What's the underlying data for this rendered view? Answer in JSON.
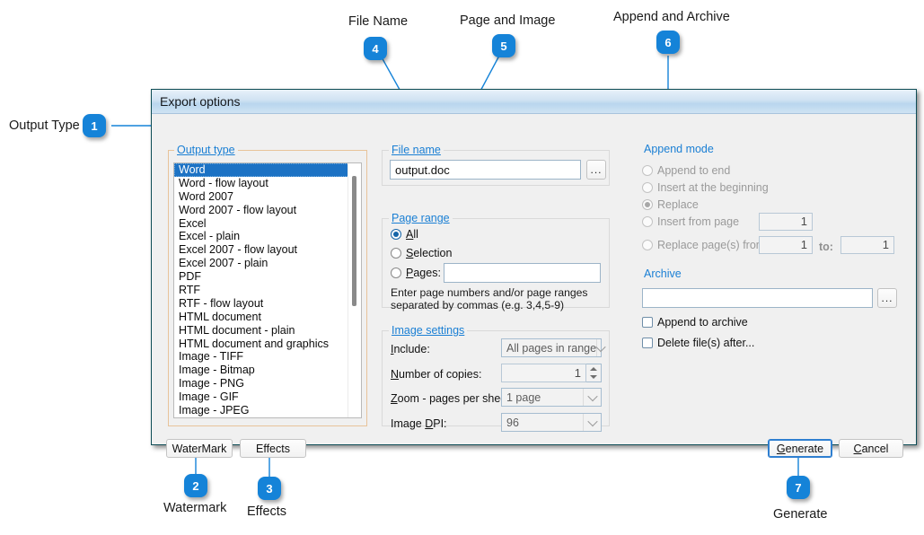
{
  "dialog": {
    "title": "Export options",
    "output_type": {
      "group_label": "Output type",
      "items": [
        "Word",
        "Word - flow layout",
        "Word 2007",
        "Word 2007 - flow layout",
        "Excel",
        "Excel - plain",
        "Excel 2007 - flow layout",
        "Excel 2007 - plain",
        "PDF",
        "RTF",
        "RTF - flow layout",
        "HTML document",
        "HTML document - plain",
        "HTML document and graphics",
        "Image - TIFF",
        "Image - Bitmap",
        "Image - PNG",
        "Image - GIF",
        "Image - JPEG"
      ],
      "selected_index": 0
    },
    "file_name": {
      "group_label": "File name",
      "value": "output.doc",
      "browse_label": "..."
    },
    "page_range": {
      "group_label": "Page range",
      "options": [
        {
          "label": "All",
          "accel": "A",
          "selected": true
        },
        {
          "label": "Selection",
          "accel": "S",
          "selected": false
        },
        {
          "label": "Pages:",
          "accel": "P",
          "selected": false
        }
      ],
      "pages_value": "",
      "hint_line1": "Enter page numbers and/or page ranges",
      "hint_line2": "separated by commas (e.g. 3,4,5-9)"
    },
    "image_settings": {
      "group_label": "Image settings",
      "rows": [
        {
          "label": "Include:",
          "accel": "I",
          "value": "All pages in range",
          "control": "combo"
        },
        {
          "label": "Number of copies:",
          "accel": "N",
          "value": "1",
          "control": "spinner"
        },
        {
          "label": "Zoom - pages per sheet:",
          "accel": "Z",
          "value": "1 page",
          "control": "combo"
        },
        {
          "label": "Image DPI:",
          "accel": "D",
          "value": "96",
          "control": "combo"
        }
      ]
    },
    "append_mode": {
      "group_label": "Append mode",
      "options": [
        {
          "label": "Append to end",
          "selected": false
        },
        {
          "label": "Insert at the beginning",
          "selected": false
        },
        {
          "label": "Replace",
          "selected": true
        },
        {
          "label": "Insert from page",
          "selected": false,
          "value": "1"
        },
        {
          "label": "Replace page(s) from:",
          "selected": false,
          "value": "1",
          "to_label": "to:",
          "to_value": "1"
        }
      ]
    },
    "archive": {
      "group_label": "Archive",
      "path_value": "",
      "browse_label": "...",
      "checkboxes": [
        {
          "label": "Append to archive",
          "checked": false
        },
        {
          "label": "Delete file(s) after...",
          "checked": false
        }
      ]
    },
    "buttons": {
      "watermark": "WaterMark",
      "effects": "Effects",
      "generate": "Generate",
      "generate_accel": "G",
      "cancel": "Cancel",
      "cancel_accel": "C"
    }
  },
  "annotations": [
    {
      "n": "1",
      "label": "Output Type"
    },
    {
      "n": "2",
      "label": "Watermark"
    },
    {
      "n": "3",
      "label": "Effects"
    },
    {
      "n": "4",
      "label": "File Name"
    },
    {
      "n": "5",
      "label": "Page and Image"
    },
    {
      "n": "6",
      "label": "Append and Archive"
    },
    {
      "n": "7",
      "label": "Generate"
    }
  ],
  "colors": {
    "accent": "#1583d8",
    "group_label": "#1a7fd4",
    "selection": "#1c72c4",
    "dialog_border": "#0d4c55"
  }
}
